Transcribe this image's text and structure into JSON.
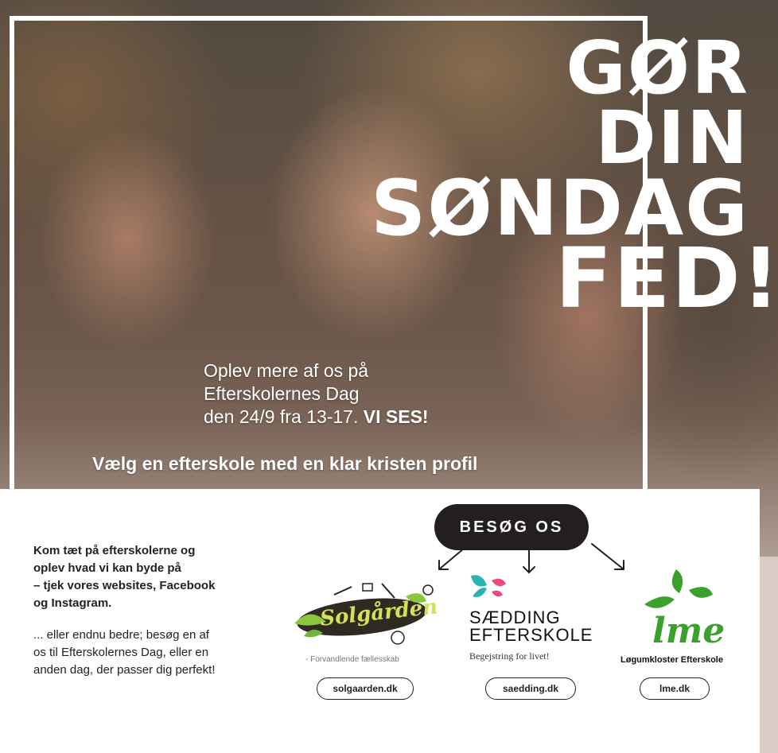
{
  "headline": {
    "line1": "GØR",
    "line2": "DIN",
    "line3": "SØNDAG",
    "line4": "FED!"
  },
  "subtext": {
    "line1": "Oplev mere af os på",
    "line2": "Efterskolernes Dag",
    "line3_prefix": "den 24/9 fra 13-17. ",
    "line3_bold": "VI SES!"
  },
  "slogan": "Vælg en efterskole med en klar kristen profil",
  "intro": {
    "bold_lines": [
      "Kom tæt på efterskolerne og",
      "oplev hvad vi kan byde på",
      "– tjek vores websites, Facebook",
      "og Instagram."
    ],
    "lines": [
      "... eller endnu bedre; besøg en af",
      "os til Efterskolernes Dag, eller en",
      "anden dag, der passer dig perfekt!"
    ]
  },
  "visit_button": "BESØG OS",
  "schools": [
    {
      "logo_text": "Solgården",
      "tagline": "- Forvandlende fællesskab",
      "url": "solgaarden.dk"
    },
    {
      "logo_text": "SÆDDING EFTERSKOLE",
      "tagline": "Begejstring for livet!",
      "url": "saedding.dk"
    },
    {
      "logo_text": "lme",
      "tagline": "Løgumkloster Efterskole",
      "url": "lme.dk"
    }
  ],
  "colors": {
    "dark": "#231f20",
    "green": "#3aa12d",
    "teal": "#2ab3b1",
    "pink": "#e94b7a"
  }
}
